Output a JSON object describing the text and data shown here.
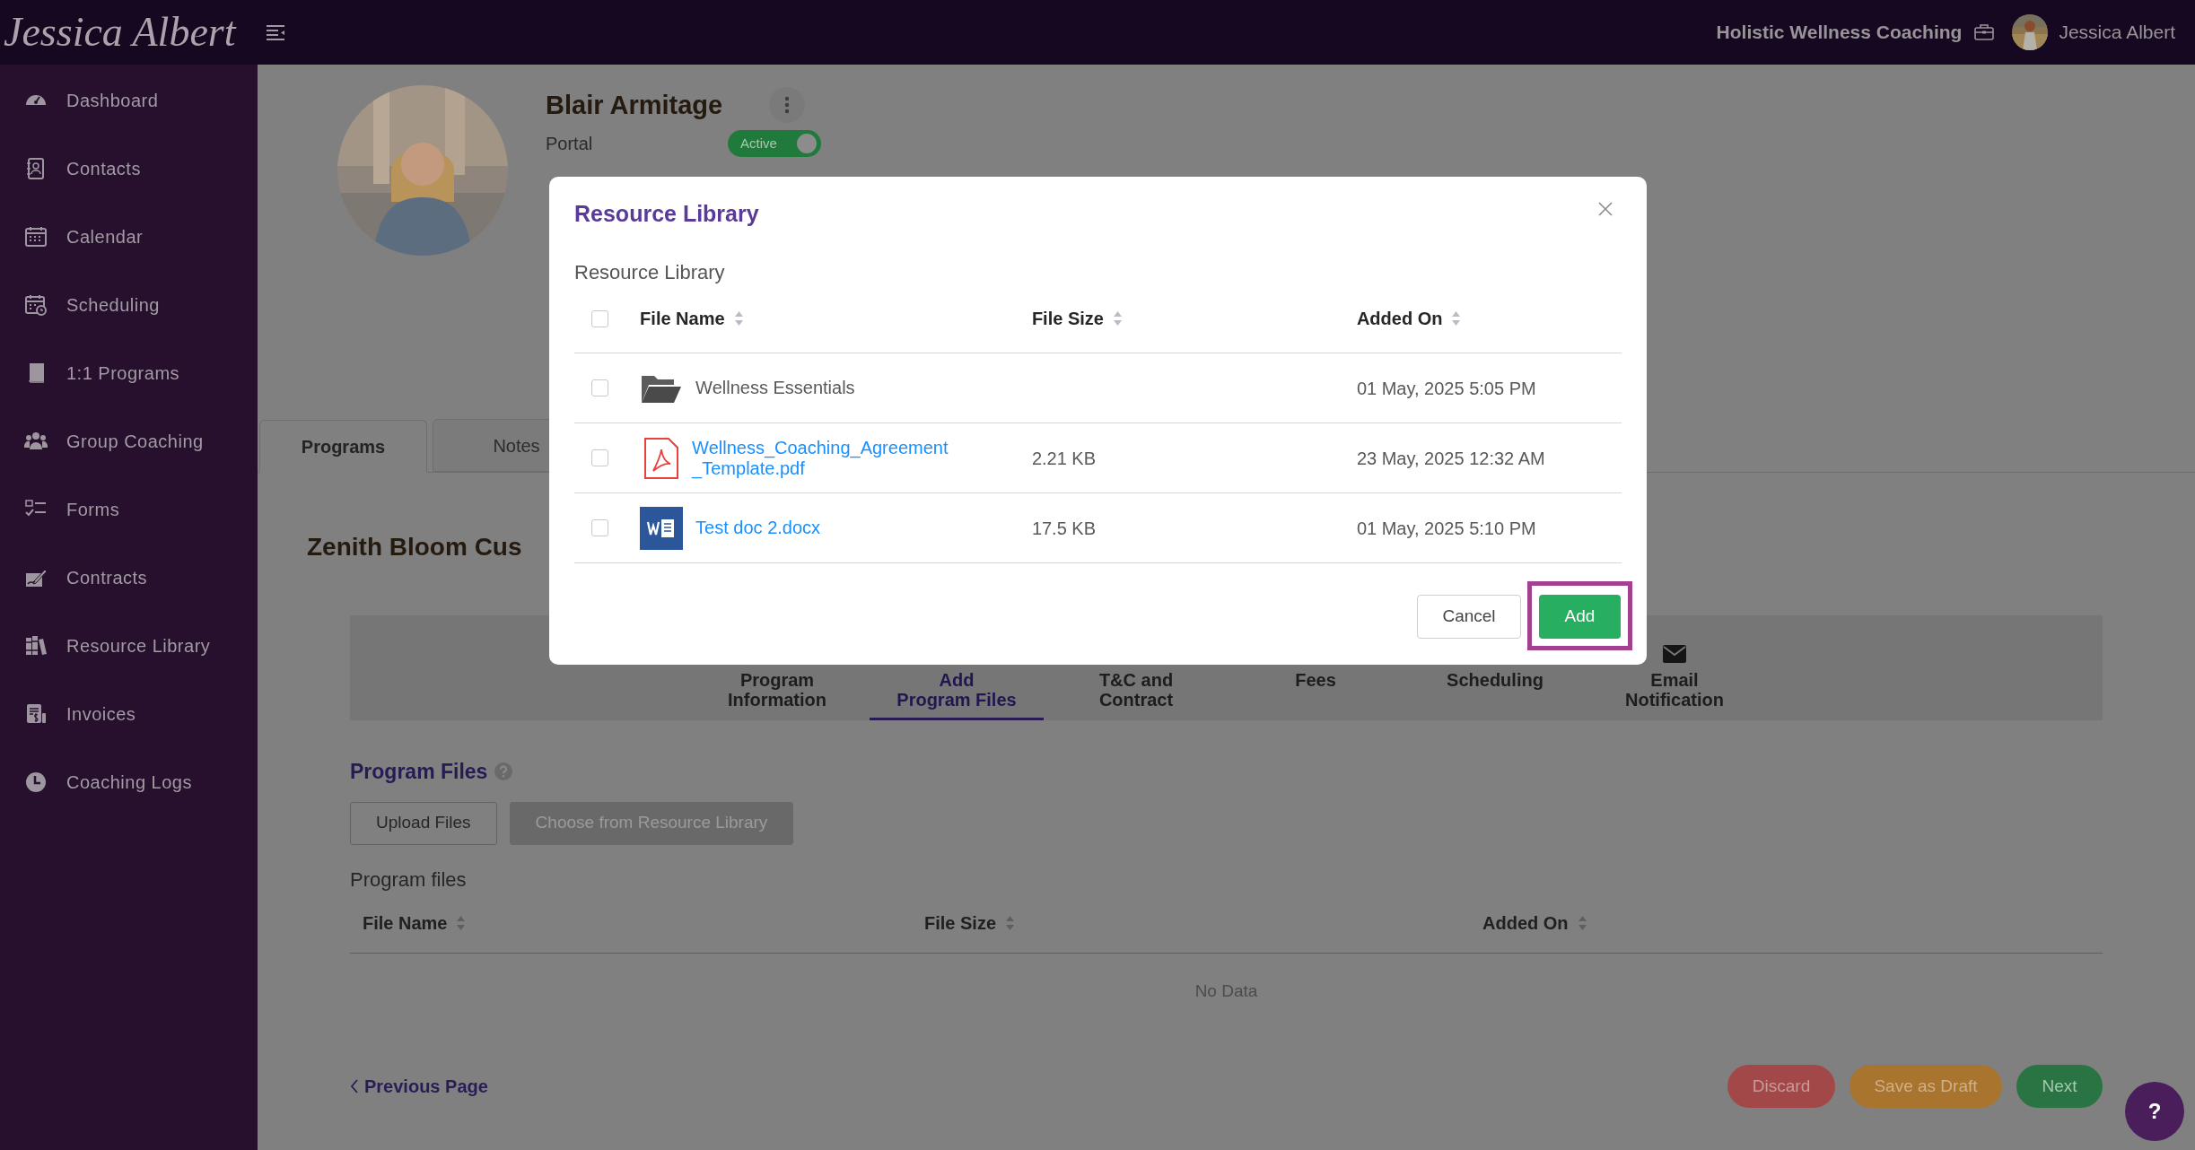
{
  "header": {
    "logo": "Jessica Albert",
    "business": "Holistic Wellness Coaching",
    "user": "Jessica Albert"
  },
  "sidebar": {
    "items": [
      {
        "label": "Dashboard",
        "kind": "gauge"
      },
      {
        "label": "Contacts",
        "kind": "contacts"
      },
      {
        "label": "Calendar",
        "kind": "calendar"
      },
      {
        "label": "Scheduling",
        "kind": "schedule"
      },
      {
        "label": "1:1 Programs",
        "kind": "book"
      },
      {
        "label": "Group Coaching",
        "kind": "group"
      },
      {
        "label": "Forms",
        "kind": "checklist"
      },
      {
        "label": "Contracts",
        "kind": "signature"
      },
      {
        "label": "Resource Library",
        "kind": "books"
      },
      {
        "label": "Invoices",
        "kind": "invoice"
      },
      {
        "label": "Coaching Logs",
        "kind": "clock"
      }
    ]
  },
  "profile": {
    "name": "Blair Armitage",
    "portal_label": "Portal",
    "portal_toggle": {
      "label": "Active",
      "on": true
    }
  },
  "tabs": [
    {
      "label": "Programs",
      "selected": true
    },
    {
      "label": "Notes",
      "selected": false
    }
  ],
  "program_title": "Zenith Bloom Cus",
  "steps": [
    {
      "label": "Program\nInformation",
      "selected": false,
      "kind": "text"
    },
    {
      "label": "Add\nProgram Files",
      "selected": true,
      "kind": "text"
    },
    {
      "label": "T&C and\nContract",
      "selected": false,
      "kind": "text"
    },
    {
      "label": "Fees",
      "selected": false,
      "kind": "text"
    },
    {
      "label": "Scheduling",
      "selected": false,
      "kind": "text"
    },
    {
      "label": "Email\nNotification",
      "selected": false,
      "kind": "mail"
    }
  ],
  "program_files": {
    "title": "Program Files",
    "buttons": [
      {
        "label": "Upload Files",
        "kind": "outline"
      },
      {
        "label": "Choose from Resource Library",
        "kind": "filled"
      }
    ],
    "subtitle": "Program files",
    "columns": [
      "File Name",
      "File Size",
      "Added On"
    ],
    "empty": "No Data"
  },
  "footer": {
    "back": "Previous Page",
    "buttons": [
      {
        "label": "Discard",
        "kind": "danger"
      },
      {
        "label": "Save as Draft",
        "kind": "warning"
      },
      {
        "label": "Next",
        "kind": "primary"
      }
    ]
  },
  "help_button": "?",
  "modal": {
    "title": "Resource Library",
    "subtitle": "Resource Library",
    "select_all_checked": false,
    "columns": [
      "File Name",
      "File Size",
      "Added On"
    ],
    "rows": [
      {
        "kind": "folder",
        "name": "Wellness Essentials",
        "added": "01 May, 2025 5:05 PM",
        "checked": false
      },
      {
        "kind": "pdf",
        "name": "Wellness_Coaching_Agreement_Template.pdf",
        "size": "2.21 KB",
        "added": "23 May, 2025 12:32 AM",
        "checked": false
      },
      {
        "kind": "word",
        "name": "Test doc 2.docx",
        "size": "17.5 KB",
        "added": "01 May, 2025 5:10 PM",
        "checked": false
      }
    ],
    "buttons": [
      {
        "label": "Cancel",
        "kind": "secondary",
        "highlighted": false
      },
      {
        "label": "Add",
        "kind": "primary",
        "highlighted": true
      }
    ]
  }
}
